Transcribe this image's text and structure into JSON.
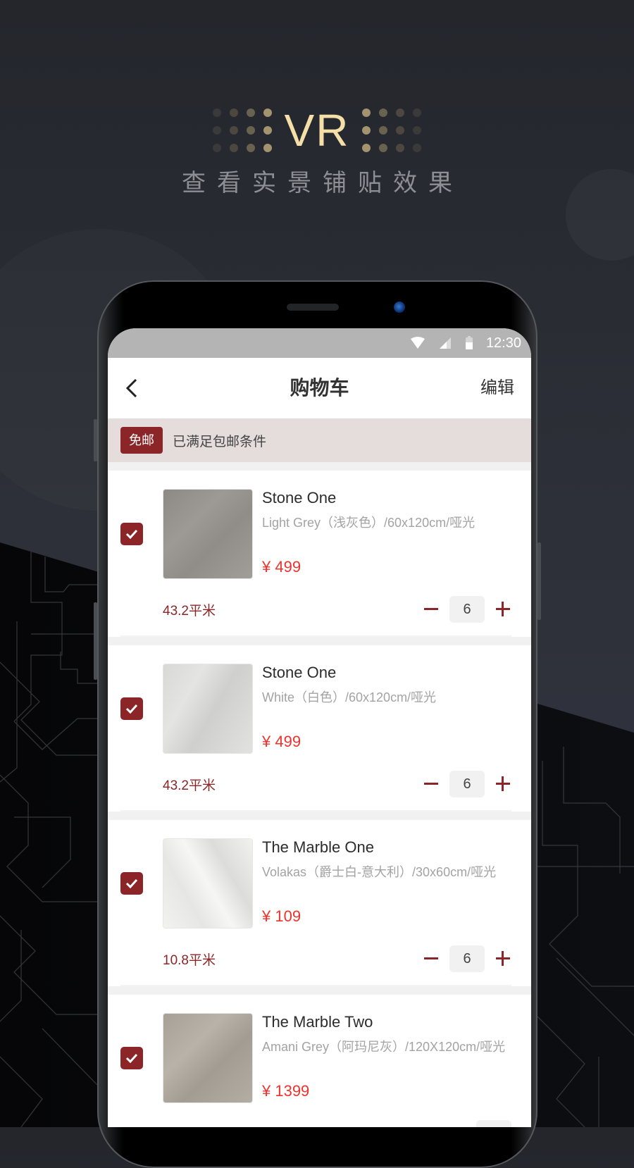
{
  "hero": {
    "title": "VR",
    "subtitle": "查看实景铺贴效果"
  },
  "statusbar": {
    "time": "12:30",
    "icons": [
      "wifi-icon",
      "cellular-signal-icon",
      "battery-icon"
    ]
  },
  "navbar": {
    "back_icon": "chevron-left-icon",
    "title": "购物车",
    "edit_label": "编辑"
  },
  "free_shipping": {
    "badge": "免邮",
    "text": "已满足包邮条件"
  },
  "colors": {
    "accent": "#8c2527",
    "price": "#f0322c",
    "gold": "#f5dfa8"
  },
  "cart": {
    "items": [
      {
        "name": "Stone One",
        "spec": "Light Grey（浅灰色）/60x120cm/哑光",
        "price": "¥ 499",
        "area": "43.2平米",
        "qty": "6",
        "checked": true
      },
      {
        "name": "Stone One",
        "spec": "White（白色）/60x120cm/哑光",
        "price": "¥ 499",
        "area": "43.2平米",
        "qty": "6",
        "checked": true
      },
      {
        "name": "The Marble One",
        "spec": "Volakas（爵士白-意大利）/30x60cm/哑光",
        "price": "¥ 109",
        "area": "10.8平米",
        "qty": "6",
        "checked": true
      },
      {
        "name": "The Marble Two",
        "spec": "Amani Grey（阿玛尼灰）/120X120cm/哑光",
        "price": "¥ 1399",
        "area": "",
        "qty": "",
        "checked": true
      }
    ]
  }
}
